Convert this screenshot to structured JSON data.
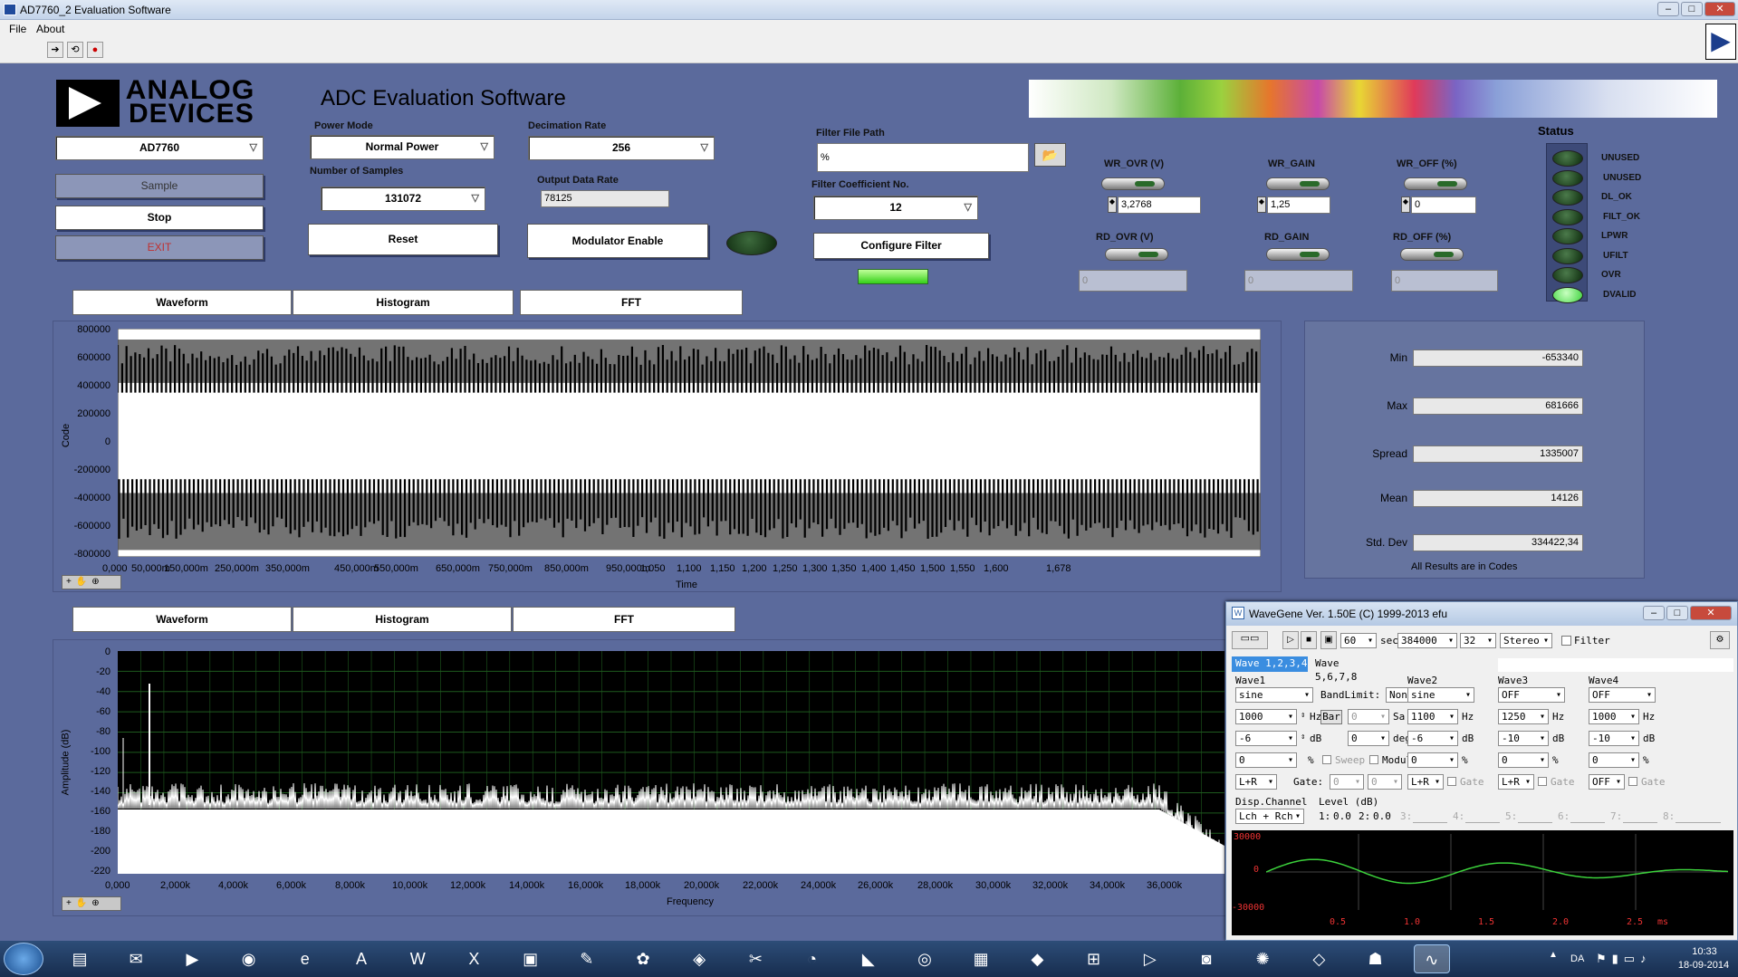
{
  "window": {
    "title": "AD7760_2 Evaluation Software",
    "min": "–",
    "max": "□",
    "close": "✕"
  },
  "menu": {
    "file": "File",
    "about": "About"
  },
  "header": {
    "logo_line1": "ANALOG",
    "logo_line2": "DEVICES",
    "app_title": "ADC Evaluation Software"
  },
  "device": {
    "selected": "AD7760"
  },
  "buttons": {
    "sample": "Sample",
    "stop": "Stop",
    "exit": "EXIT",
    "reset": "Reset",
    "modulator": "Modulator Enable",
    "configure": "Configure Filter"
  },
  "power": {
    "label": "Power Mode",
    "value": "Normal Power"
  },
  "samples": {
    "label": "Number of Samples",
    "value": "131072"
  },
  "decimation": {
    "label": "Decimation Rate",
    "value": "256"
  },
  "odr": {
    "label": "Output Data Rate",
    "value": "78125"
  },
  "filter": {
    "path_label": "Filter File Path",
    "path_value": "%",
    "coef_label": "Filter Coefficient No.",
    "coef_value": "12"
  },
  "regs": {
    "wr_ovr": {
      "label": "WR_OVR (V)",
      "value": "3,2768"
    },
    "wr_gain": {
      "label": "WR_GAIN",
      "value": "1,25"
    },
    "wr_off": {
      "label": "WR_OFF (%)",
      "value": "0"
    },
    "rd_ovr": {
      "label": "RD_OVR (V)",
      "value": "0"
    },
    "rd_gain": {
      "label": "RD_GAIN",
      "value": "0"
    },
    "rd_off": {
      "label": "RD_OFF (%)",
      "value": "0"
    }
  },
  "status": {
    "title": "Status",
    "items": [
      {
        "label": "UNUSED",
        "on": false
      },
      {
        "label": "UNUSED",
        "on": false
      },
      {
        "label": "DL_OK",
        "on": false
      },
      {
        "label": "FILT_OK",
        "on": false
      },
      {
        "label": "LPWR",
        "on": false
      },
      {
        "label": "UFILT",
        "on": false
      },
      {
        "label": "OVR",
        "on": false
      },
      {
        "label": "DVALID",
        "on": true
      }
    ]
  },
  "tabs_top": [
    "Waveform",
    "Histogram",
    "FFT"
  ],
  "tabs_bottom": [
    "Waveform",
    "Histogram",
    "FFT"
  ],
  "plot_time": {
    "ylabel": "Code",
    "xlabel": "Time",
    "yticks": [
      "800000",
      "600000",
      "400000",
      "200000",
      "0",
      "-200000",
      "-400000",
      "-600000",
      "-800000"
    ],
    "xticks": [
      "0,000",
      "50,000m",
      "150,000m",
      "250,000m",
      "350,000m",
      "450,000m",
      "550,000m",
      "650,000m",
      "750,000m",
      "850,000m",
      "950,000m",
      "1,050",
      "1,100",
      "1,150",
      "1,200",
      "1,250",
      "1,300",
      "1,350",
      "1,400",
      "1,450",
      "1,500",
      "1,550",
      "1,600",
      "1,678"
    ]
  },
  "plot_fft": {
    "ylabel": "Amplitude (dB)",
    "xlabel": "Frequency",
    "yticks": [
      "0",
      "-20",
      "-40",
      "-60",
      "-80",
      "-100",
      "-120",
      "-140",
      "-160",
      "-180",
      "-200",
      "-220"
    ],
    "xticks": [
      "0,000",
      "2,000k",
      "4,000k",
      "6,000k",
      "8,000k",
      "10,000k",
      "12,000k",
      "14,000k",
      "16,000k",
      "18,000k",
      "20,000k",
      "22,000k",
      "24,000k",
      "26,000k",
      "28,000k",
      "30,000k",
      "32,000k",
      "34,000k",
      "36,000k"
    ]
  },
  "stats": {
    "rows": [
      {
        "label": "Min",
        "value": "-653340"
      },
      {
        "label": "Max",
        "value": "681666"
      },
      {
        "label": "Spread",
        "value": "1335007"
      },
      {
        "label": "Mean",
        "value": "14126"
      },
      {
        "label": "Std. Dev",
        "value": "334422,34"
      }
    ],
    "note": "All Results are in Codes"
  },
  "wavegene": {
    "title": "WaveGene  Ver. 1.50E  (C) 1999-2013 efu",
    "duration": "60",
    "sec": "sec",
    "rate": "384000",
    "bits": "32",
    "stereo": "Stereo",
    "filter": "Filter",
    "tab1": "Wave 1,2,3,4",
    "tab2": "Wave 5,6,7,8",
    "w1": {
      "name": "Wave1",
      "type": "sine",
      "freq": "1000",
      "hz": "Hz",
      "level": "-6",
      "db": "dB",
      "pct": "0",
      "pct_u": "%",
      "chan": "L+R"
    },
    "bandlimit": {
      "label": "BandLimit:",
      "value": "None",
      "bar": "Bar",
      "sa": "0",
      "sa_u": "Sa",
      "deg": "0",
      "deg_u": "deg",
      "sweep": "Sweep",
      "modul": "Modul"
    },
    "w2": {
      "name": "Wave2",
      "type": "sine",
      "freq": "1100",
      "level": "-6",
      "pct": "0",
      "chan": "L+R",
      "gate": "Gate"
    },
    "w3": {
      "name": "Wave3",
      "type": "OFF",
      "freq": "1250",
      "level": "-10",
      "pct": "0",
      "chan": "L+R",
      "gate": "Gate"
    },
    "w4": {
      "name": "Wave4",
      "type": "OFF",
      "freq": "1000",
      "level": "-10",
      "pct": "0",
      "chan": "OFF",
      "gate": "Gate"
    },
    "gate": {
      "label": "Gate:",
      "a": "0",
      "b": "0"
    },
    "disp": {
      "label": "Disp.Channel",
      "value": "Lch + Rch",
      "level_label": "Level (dB)",
      "l1": "1:",
      "v1": "0.0",
      "l2": "2:",
      "v2": "0.0",
      "l3": "3:",
      "l4": "4:",
      "l5": "5:",
      "l6": "6:",
      "l7": "7:",
      "l8": "8:"
    },
    "scope": {
      "ymax": "30000",
      "ymid": "0",
      "ymin": "-30000",
      "xticks": [
        "0.5",
        "1.0",
        "1.5",
        "2.0",
        "2.5"
      ],
      "unit": "ms"
    }
  },
  "tray": {
    "lang": "DA",
    "time": "10:33",
    "date": "18-09-2014"
  },
  "colors": {
    "panel": "#5b6a9c",
    "plot_time_bg": "#ffffff",
    "plot_fft_bg": "#000000",
    "grid": "#1e5a1e",
    "led_on": "#3cd23c"
  }
}
